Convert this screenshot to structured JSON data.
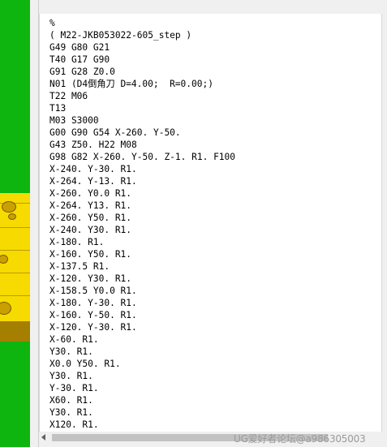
{
  "editor": {
    "lines": [
      "%",
      "( M22-JKB053022-605_step )",
      "G49 G80 G21",
      "T40 G17 G90",
      "G91 G28 Z0.0",
      "N01 (D4倒角刀 D=4.00;  R=0.00;)",
      "T22 M06",
      "T13",
      "M03 S3000",
      "G00 G90 G54 X-260. Y-50.",
      "G43 Z50. H22 M08",
      "G98 G82 X-260. Y-50. Z-1. R1. F100",
      "X-240. Y-30. R1.",
      "X-264. Y-13. R1.",
      "X-260. Y0.0 R1.",
      "X-264. Y13. R1.",
      "X-260. Y50. R1.",
      "X-240. Y30. R1.",
      "X-180. R1.",
      "X-160. Y50. R1.",
      "X-137.5 R1.",
      "X-120. Y30. R1.",
      "X-158.5 Y0.0 R1.",
      "X-180. Y-30. R1.",
      "X-160. Y-50. R1.",
      "X-120. Y-30. R1.",
      "X-60. R1.",
      "Y30. R1.",
      "X0.0 Y50. R1.",
      "Y30. R1.",
      "Y-30. R1.",
      "X60. R1.",
      "Y30. R1.",
      "X120. R1."
    ]
  },
  "watermark": "UG爱好者论坛@a986305003",
  "colors": {
    "viewport_green": "#0fb50f",
    "part_yellow": "#f7da00",
    "part_base": "#a57f00"
  }
}
